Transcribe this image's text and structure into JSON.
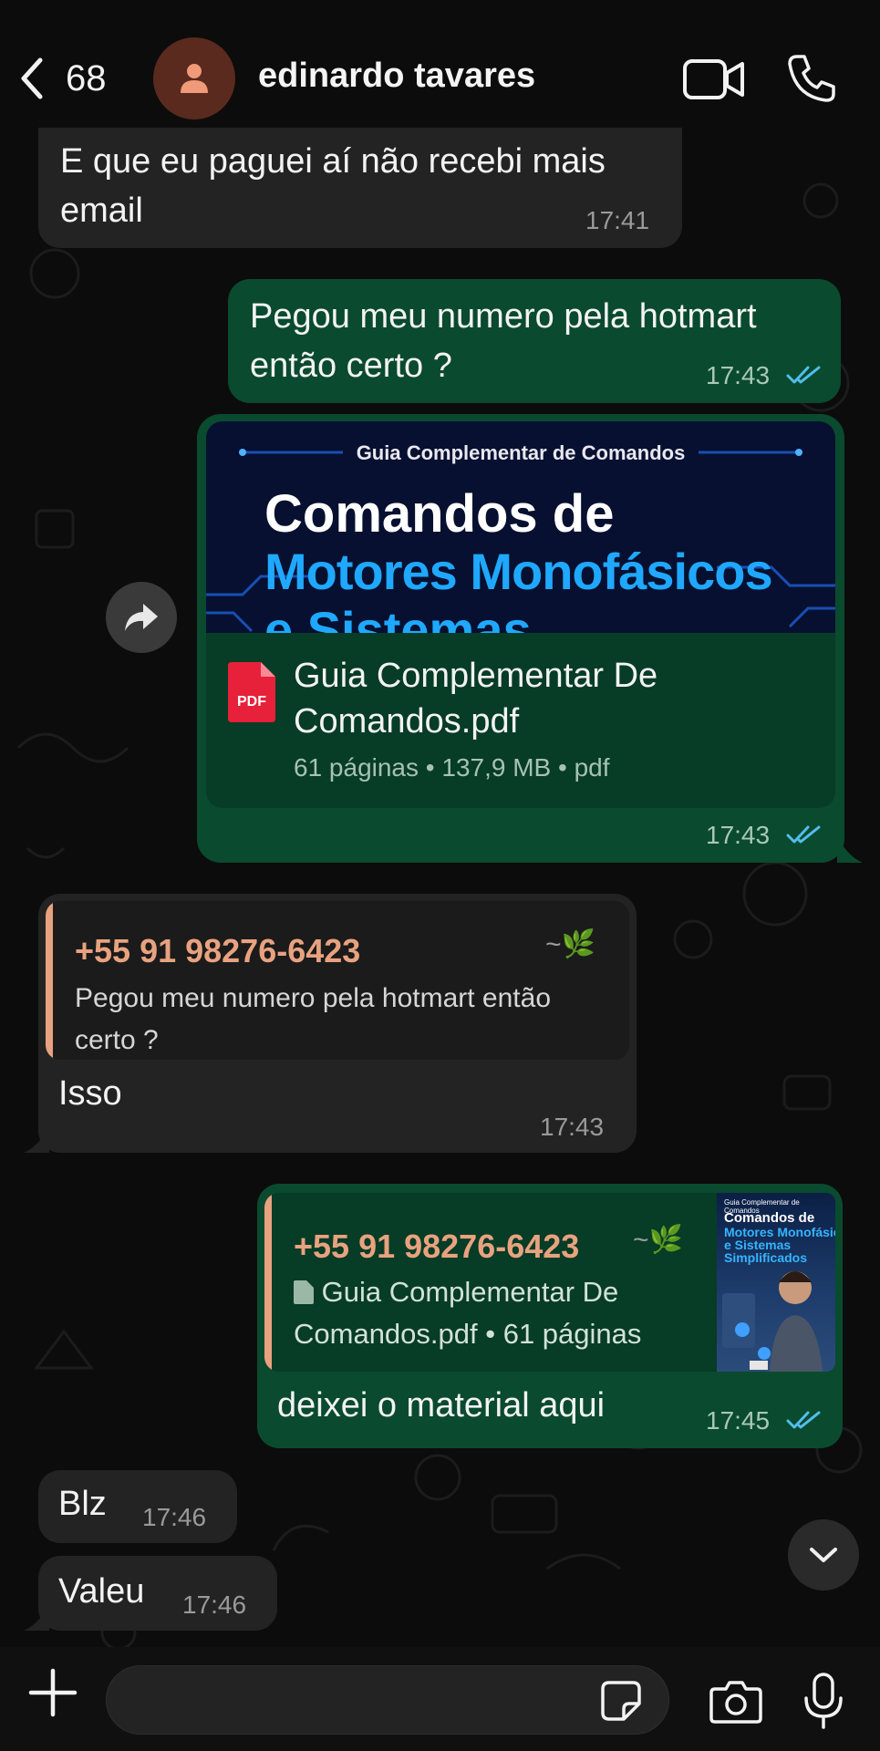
{
  "header": {
    "back_count": "68",
    "contact_name": "edinardo tavares",
    "icons": [
      "chevron-left-icon",
      "person-icon",
      "video-camera-icon",
      "phone-icon"
    ]
  },
  "messages": [
    {
      "direction": "in",
      "text_line1": "E que eu paguei aí não recebi mais",
      "text_line2": "email",
      "time": "17:41"
    },
    {
      "direction": "out",
      "text_line1": "Pegou meu numero pela hotmart",
      "text_line2": "então certo ?",
      "time": "17:43",
      "status": "read"
    },
    {
      "direction": "out",
      "type": "document",
      "preview": {
        "subtitle": "Guia Complementar de Comandos",
        "line1": "Comandos de",
        "line2": "Motores Monofásicos",
        "line3": "e Sistemas"
      },
      "file_name_line1": "Guia Complementar De",
      "file_name_line2": "Comandos.pdf",
      "file_icon_label": "PDF",
      "meta": "61 páginas • 137,9 MB • pdf",
      "time": "17:43",
      "status": "read"
    },
    {
      "direction": "in",
      "reply": {
        "name": "+55 91 98276-6423",
        "nick": "~🌿",
        "text_line1": "Pegou meu numero pela hotmart então",
        "text_line2": "certo ?"
      },
      "text": "Isso",
      "time": "17:43"
    },
    {
      "direction": "out",
      "reply": {
        "name": "+55 91 98276-6423",
        "nick": "~🌿",
        "text_line1": "Guia Complementar De",
        "text_line2": "Comandos.pdf • 61 páginas",
        "thumb_line0": "Guia Complementar de Comandos",
        "thumb_line1": "Comandos de",
        "thumb_line2": "Motores Monofásicos",
        "thumb_line3": "e Sistemas",
        "thumb_line4": "Simplificados"
      },
      "text": "deixei o material aqui",
      "time": "17:45",
      "status": "read"
    },
    {
      "direction": "in",
      "text": "Blz",
      "time": "17:46"
    },
    {
      "direction": "in",
      "text": "Valeu",
      "time": "17:46"
    }
  ],
  "footer": {
    "compose_placeholder": "",
    "icons": [
      "plus-icon",
      "sticker-icon",
      "camera-icon",
      "microphone-icon"
    ]
  },
  "colors": {
    "incoming_bubble": "#232323",
    "outgoing_bubble": "#0a4a2f",
    "reply_accent": "#e8a27f",
    "read_ticks": "#53bdeb"
  }
}
